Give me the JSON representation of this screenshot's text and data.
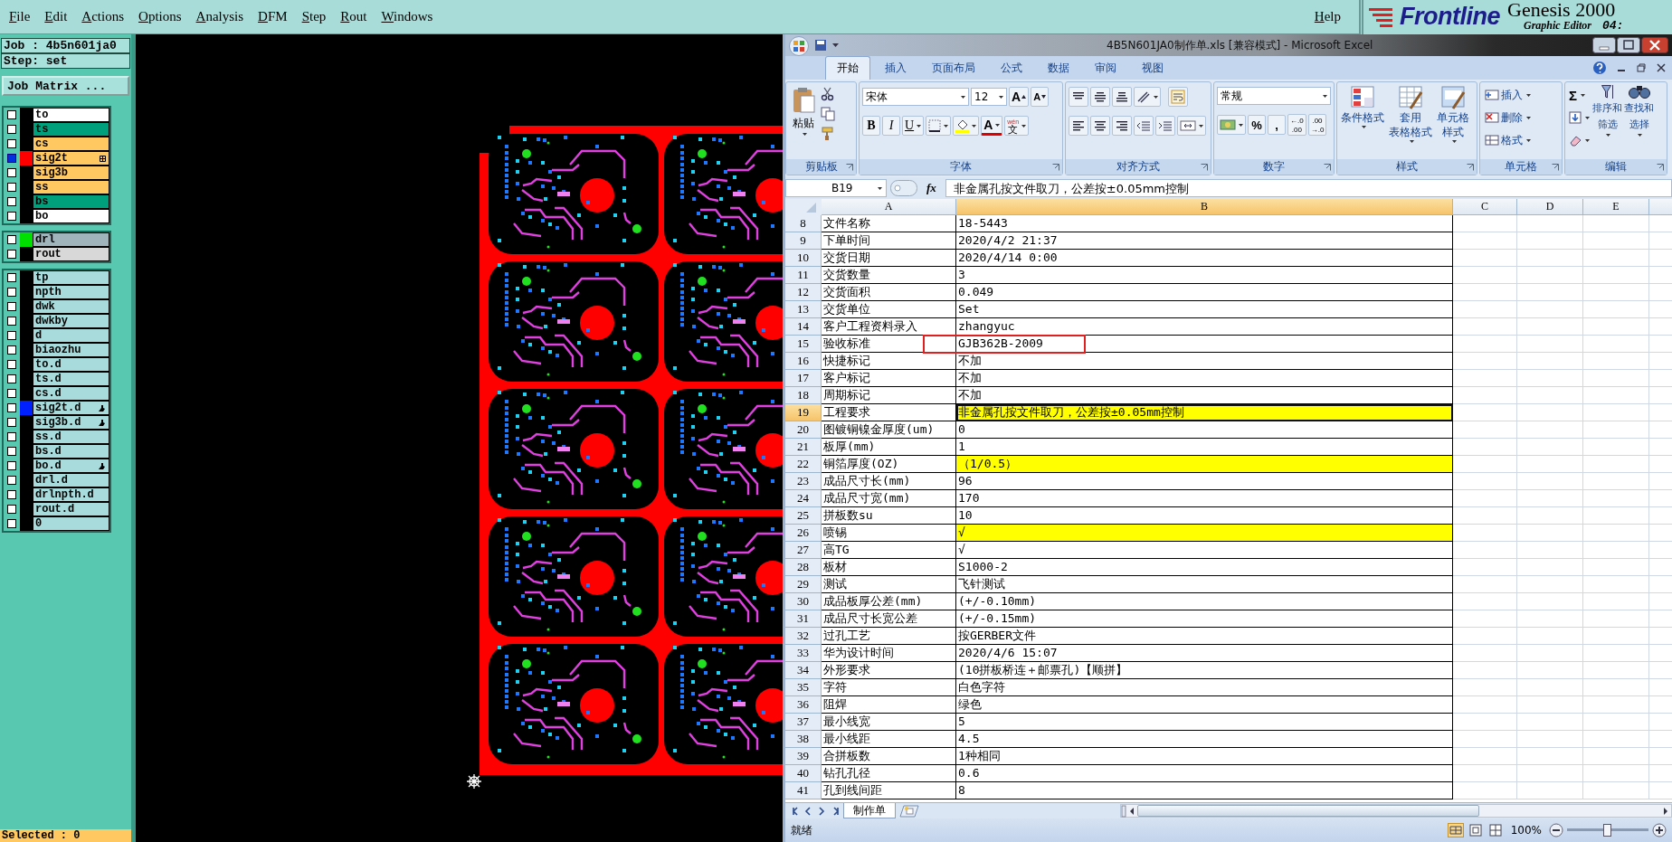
{
  "menu_bar": {
    "items": [
      "File",
      "Edit",
      "Actions",
      "Options",
      "Analysis",
      "DFM",
      "Step",
      "Rout",
      "Windows"
    ],
    "help": "Help"
  },
  "brand": {
    "logo": "Frontline",
    "product": "Genesis 2000",
    "subtitle": "Graphic Editor",
    "clock": "04:"
  },
  "job_panel": {
    "job": "Job : 4b5n601ja0",
    "step": "Step: set",
    "matrix_button": "Job Matrix ...",
    "layer_groups": [
      [
        {
          "name": "to",
          "kind": "silk",
          "selected": false,
          "grid": false,
          "pointer": false
        },
        {
          "name": "ts",
          "kind": "mask",
          "selected": false,
          "grid": false,
          "pointer": false
        },
        {
          "name": "cs",
          "kind": "signal",
          "selected": false,
          "grid": false,
          "pointer": false
        },
        {
          "name": "sig2t",
          "kind": "signal",
          "selected": true,
          "color": "#ff0000",
          "grid": true,
          "pointer": false
        },
        {
          "name": "sig3b",
          "kind": "signal",
          "selected": false,
          "grid": false,
          "pointer": false
        },
        {
          "name": "ss",
          "kind": "signal",
          "selected": false,
          "grid": false,
          "pointer": false
        },
        {
          "name": "bs",
          "kind": "mask",
          "selected": false,
          "grid": false,
          "pointer": false
        },
        {
          "name": "bo",
          "kind": "silk",
          "selected": false,
          "grid": false,
          "pointer": false
        }
      ],
      [
        {
          "name": "drl",
          "kind": "drill",
          "selected": false,
          "color": "#00e000",
          "grid": false,
          "pointer": false
        },
        {
          "name": "rout",
          "kind": "rout",
          "selected": false,
          "grid": false,
          "pointer": false
        }
      ],
      [
        {
          "name": "tp",
          "kind": "document",
          "selected": false,
          "grid": false,
          "pointer": false
        },
        {
          "name": "npth",
          "kind": "document",
          "selected": false,
          "grid": false,
          "pointer": false
        },
        {
          "name": "dwk",
          "kind": "document",
          "selected": false,
          "grid": false,
          "pointer": false
        },
        {
          "name": "dwkby",
          "kind": "document",
          "selected": false,
          "grid": false,
          "pointer": false
        },
        {
          "name": "d",
          "kind": "document",
          "selected": false,
          "grid": false,
          "pointer": false
        },
        {
          "name": "biaozhu",
          "kind": "document",
          "selected": false,
          "grid": false,
          "pointer": false
        },
        {
          "name": "to.d",
          "kind": "document",
          "selected": false,
          "grid": false,
          "pointer": false
        },
        {
          "name": "ts.d",
          "kind": "document",
          "selected": false,
          "grid": false,
          "pointer": false
        },
        {
          "name": "cs.d",
          "kind": "document",
          "selected": false,
          "grid": false,
          "pointer": false
        },
        {
          "name": "sig2t.d",
          "kind": "document",
          "selected": false,
          "color": "#0020ff",
          "grid": false,
          "pointer": true
        },
        {
          "name": "sig3b.d",
          "kind": "document",
          "selected": false,
          "grid": false,
          "pointer": true
        },
        {
          "name": "ss.d",
          "kind": "document",
          "selected": false,
          "grid": false,
          "pointer": false
        },
        {
          "name": "bs.d",
          "kind": "document",
          "selected": false,
          "grid": false,
          "pointer": false
        },
        {
          "name": "bo.d",
          "kind": "document",
          "selected": false,
          "grid": false,
          "pointer": true
        },
        {
          "name": "drl.d",
          "kind": "document",
          "selected": false,
          "grid": false,
          "pointer": false
        },
        {
          "name": "drlnpth.d",
          "kind": "document",
          "selected": false,
          "grid": false,
          "pointer": false
        },
        {
          "name": "rout.d",
          "kind": "document",
          "selected": false,
          "grid": false,
          "pointer": false
        },
        {
          "name": "0",
          "kind": "document",
          "selected": false,
          "grid": false,
          "pointer": false
        }
      ]
    ],
    "selection_status": "Selected : 0"
  },
  "excel": {
    "title": "4B5N601JA0制作单.xls  [兼容模式] - Microsoft Excel",
    "tabs": [
      {
        "label": "开始",
        "selected": true
      },
      {
        "label": "插入",
        "selected": false
      },
      {
        "label": "页面布局",
        "selected": false
      },
      {
        "label": "公式",
        "selected": false
      },
      {
        "label": "数据",
        "selected": false
      },
      {
        "label": "审阅",
        "selected": false
      },
      {
        "label": "视图",
        "selected": false
      }
    ],
    "clipboard": {
      "paste": "粘贴",
      "group": "剪贴板"
    },
    "font": {
      "name": "宋体",
      "size": "12",
      "grow": "A",
      "shrink": "A",
      "bold": "B",
      "italic": "I",
      "underline": "U",
      "color_letter": "A",
      "phonetic_top": "wén",
      "phonetic": "文",
      "group": "字体"
    },
    "alignment": {
      "group": "对齐方式"
    },
    "number": {
      "format": "常规",
      "percent": "%",
      "comma": ",",
      "increase_decimal": [
        "←.0",
        ".00"
      ],
      "decrease_decimal": [
        ".00",
        "→.0"
      ],
      "group": "数字"
    },
    "styles": {
      "buttons": [
        [
          "条件格式"
        ],
        [
          "套用",
          "表格格式"
        ],
        [
          "单元格",
          "样式"
        ]
      ],
      "group": "样式"
    },
    "cells": {
      "buttons": [
        "插入",
        "删除",
        "格式"
      ],
      "group": "单元格"
    },
    "editing": {
      "sum": "Σ",
      "buttons": [
        [
          "排序和",
          "筛选"
        ],
        [
          "查找和",
          "选择"
        ]
      ],
      "group": "编辑"
    },
    "name_box": "B19",
    "fx": "fx",
    "formula": "非金属孔按文件取刀，公差按±0.05mm控制",
    "columns": [
      {
        "label": "A",
        "selected": false
      },
      {
        "label": "B",
        "selected": true
      },
      {
        "label": "C",
        "selected": false
      },
      {
        "label": "D",
        "selected": false
      },
      {
        "label": "E",
        "selected": false
      }
    ],
    "rows": [
      {
        "n": "8",
        "a": "文件名称",
        "b": "18-5443",
        "selected": false,
        "boxed": false
      },
      {
        "n": "9",
        "a": "下单时间",
        "b": "2020/4/2 21:37",
        "selected": false,
        "boxed": false
      },
      {
        "n": "10",
        "a": "交货日期",
        "b": "2020/4/14 0:00",
        "selected": false,
        "boxed": false
      },
      {
        "n": "11",
        "a": "交货数量",
        "b": "3",
        "selected": false,
        "boxed": false
      },
      {
        "n": "12",
        "a": "交货面积",
        "b": "0.049",
        "selected": false,
        "boxed": false
      },
      {
        "n": "13",
        "a": "交货单位",
        "b": "Set",
        "selected": false,
        "boxed": false
      },
      {
        "n": "14",
        "a": "客户工程资料录入",
        "b": "zhangyuc",
        "selected": false,
        "boxed": false
      },
      {
        "n": "15",
        "a": "验收标准",
        "b": "GJB362B-2009",
        "selected": false,
        "boxed": true
      },
      {
        "n": "16",
        "a": "快捷标记",
        "b": "不加",
        "selected": false,
        "boxed": false
      },
      {
        "n": "17",
        "a": "客户标记",
        "b": "不加",
        "selected": false,
        "boxed": false
      },
      {
        "n": "18",
        "a": "周期标记",
        "b": "不加",
        "selected": false,
        "boxed": false
      },
      {
        "n": "19",
        "a": "工程要求",
        "b": "非金属孔按文件取刀，公差按±0.05mm控制",
        "selected": true,
        "boxed": false,
        "color": "#ffff00"
      },
      {
        "n": "20",
        "a": "图镀铜镍金厚度(um)",
        "b": "0",
        "selected": false,
        "boxed": false
      },
      {
        "n": "21",
        "a": "板厚(mm)",
        "b": "1",
        "selected": false,
        "boxed": false
      },
      {
        "n": "22",
        "a": "铜箔厚度(OZ)",
        "b": "（1/0.5）",
        "selected": false,
        "boxed": false,
        "color": "#ffff00"
      },
      {
        "n": "23",
        "a": "成品尺寸长(mm)",
        "b": "96",
        "selected": false,
        "boxed": false
      },
      {
        "n": "24",
        "a": "成品尺寸宽(mm)",
        "b": "170",
        "selected": false,
        "boxed": false
      },
      {
        "n": "25",
        "a": "拼板数su",
        "b": "10",
        "selected": false,
        "boxed": false
      },
      {
        "n": "26",
        "a": "喷锡",
        "b": "√",
        "selected": false,
        "boxed": false,
        "color": "#ffff00"
      },
      {
        "n": "27",
        "a": "高TG",
        "b": "√",
        "selected": false,
        "boxed": false
      },
      {
        "n": "28",
        "a": "板材",
        "b": "S1000-2",
        "selected": false,
        "boxed": false
      },
      {
        "n": "29",
        "a": "测试",
        "b": "飞针测试",
        "selected": false,
        "boxed": false
      },
      {
        "n": "30",
        "a": "成品板厚公差(mm)",
        "b": "(+/-0.10mm)",
        "selected": false,
        "boxed": false
      },
      {
        "n": "31",
        "a": "成品尺寸长宽公差",
        "b": "(+/-0.15mm)",
        "selected": false,
        "boxed": false
      },
      {
        "n": "32",
        "a": "过孔工艺",
        "b": "按GERBER文件",
        "selected": false,
        "boxed": false
      },
      {
        "n": "33",
        "a": "华为设计时间",
        "b": "2020/4/6 15:07",
        "selected": false,
        "boxed": false
      },
      {
        "n": "34",
        "a": "外形要求",
        "b": "(10拼板桥连＋邮票孔)【顺拼】",
        "selected": false,
        "boxed": false
      },
      {
        "n": "35",
        "a": "字符",
        "b": "白色字符",
        "selected": false,
        "boxed": false
      },
      {
        "n": "36",
        "a": "阻焊",
        "b": "绿色",
        "selected": false,
        "boxed": false
      },
      {
        "n": "37",
        "a": "最小线宽",
        "b": "5",
        "selected": false,
        "boxed": false
      },
      {
        "n": "38",
        "a": "最小线距",
        "b": "4.5",
        "selected": false,
        "boxed": false
      },
      {
        "n": "39",
        "a": "合拼板数",
        "b": "1种相同",
        "selected": false,
        "boxed": false
      },
      {
        "n": "40",
        "a": "钻孔孔径",
        "b": "0.6",
        "selected": false,
        "boxed": false
      },
      {
        "n": "41",
        "a": "孔到线间距",
        "b": "8",
        "selected": false,
        "boxed": false
      }
    ],
    "sheet_tabs": [
      {
        "label": "制作单",
        "selected": true
      }
    ],
    "status": "就绪",
    "zoom": "100%",
    "zoom_slider": {
      "level": 0.5
    }
  }
}
